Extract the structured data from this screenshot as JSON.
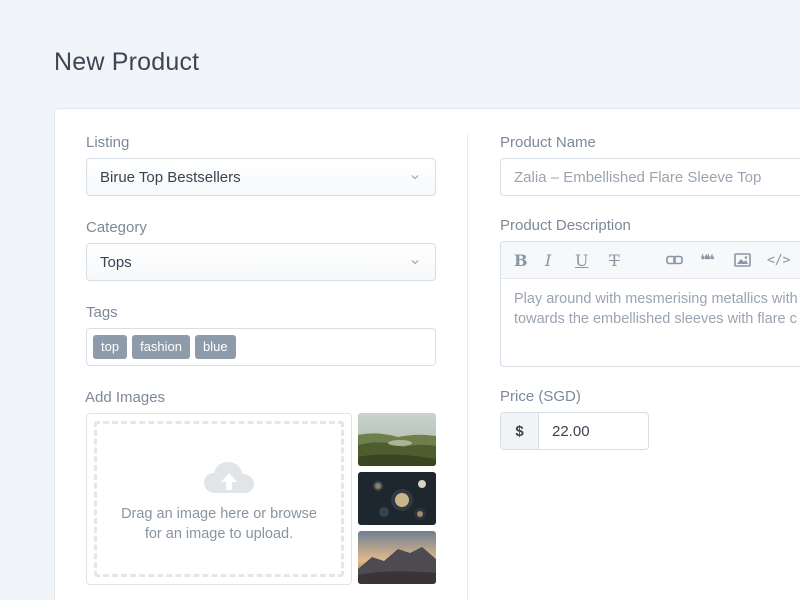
{
  "page": {
    "title": "New Product"
  },
  "listing": {
    "label": "Listing",
    "value": "Birue Top Bestsellers"
  },
  "category": {
    "label": "Category",
    "value": "Tops"
  },
  "tags": {
    "label": "Tags",
    "items": [
      "top",
      "fashion",
      "blue"
    ]
  },
  "images": {
    "label": "Add Images",
    "dropzone_text_line1": "Drag an image here or browse",
    "dropzone_text_line2": "for an image to upload."
  },
  "product_name": {
    "label": "Product Name",
    "placeholder": "Zalia – Embellished Flare Sleeve Top"
  },
  "description": {
    "label": "Product Description",
    "line1": "Play around with mesmerising metallics with",
    "line2": "towards the embellished sleeves with flare c"
  },
  "price": {
    "label": "Price (SGD)",
    "currency_symbol": "$",
    "value": "22.00"
  },
  "toolbar": {
    "bold": "B",
    "italic": "I",
    "underline": "U",
    "clear_format": "T",
    "quote": "❝❝",
    "code": "</>"
  }
}
